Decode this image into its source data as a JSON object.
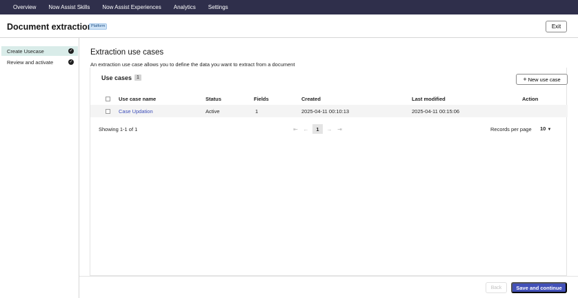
{
  "topnav": {
    "items": [
      "Overview",
      "Now Assist Skills",
      "Now Assist Experiences",
      "Analytics",
      "Settings"
    ]
  },
  "header": {
    "title": "Document extraction",
    "badge": "Platform",
    "exit_label": "Exit"
  },
  "sidebar": {
    "items": [
      {
        "label": "Create Usecase",
        "status_icon": "check-circle-icon",
        "active": true
      },
      {
        "label": "Review and activate",
        "status_icon": "check-circle-icon",
        "active": false
      }
    ]
  },
  "main": {
    "title": "Extraction use cases",
    "description": "An extraction use case allows you to define the data you want to extract from a document"
  },
  "use_cases": {
    "title": "Use cases",
    "count": "1",
    "new_button_label": "New use case",
    "columns": [
      "Use case name",
      "Status",
      "Fields",
      "Created",
      "Last modified",
      "Action"
    ],
    "rows": [
      {
        "name": "Case Updation",
        "status": "Active",
        "fields": "1",
        "created": "2025-04-11 00:10:13",
        "last_modified": "2025-04-11 00:15:06",
        "action": ""
      }
    ]
  },
  "pagination": {
    "showing": "Showing 1-1 of 1",
    "current_page": "1",
    "records_label": "Records per page",
    "records_value": "10"
  },
  "footer": {
    "back_label": "Back",
    "save_label": "Save and continue"
  },
  "colors": {
    "topnav_bg": "#2f2f4b",
    "primary": "#4351b8",
    "active_sidebar": "#d9ece9",
    "link": "#3b4cb8"
  }
}
